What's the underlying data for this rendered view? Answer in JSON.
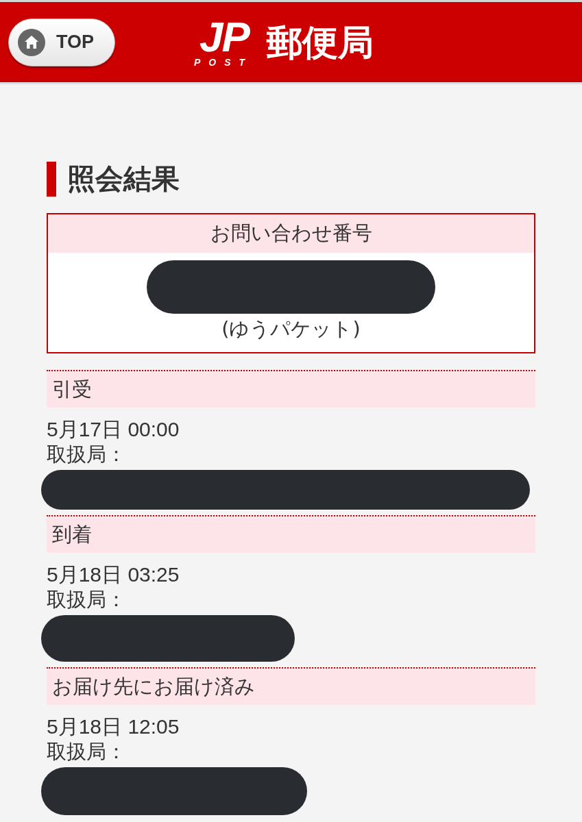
{
  "header": {
    "home_button": {
      "label": "TOP"
    },
    "logo": {
      "mark": "JP",
      "sub": "POST",
      "name": "郵便局"
    }
  },
  "title": "照会結果",
  "tracking": {
    "label": "お問い合わせ番号",
    "number_redacted": true,
    "service": "(ゆうパケット)"
  },
  "events": [
    {
      "status": "引受",
      "datetime": "5月17日 00:00",
      "office_label": "取扱局：",
      "office_redacted": true
    },
    {
      "status": "到着",
      "datetime": "5月18日 03:25",
      "office_label": "取扱局：",
      "office_redacted": true
    },
    {
      "status": "お届け先にお届け済み",
      "datetime": "5月18日 12:05",
      "office_label": "取扱局：",
      "office_redacted": true
    }
  ]
}
